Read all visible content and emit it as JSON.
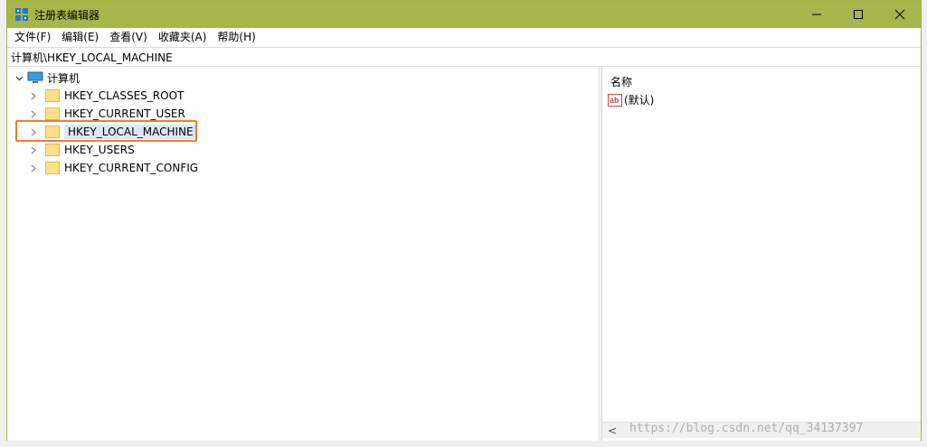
{
  "window": {
    "title": "注册表编辑器",
    "controls": [
      "minimize-icon",
      "maximize-icon",
      "close-icon"
    ]
  },
  "menubar": {
    "items": [
      {
        "label": "文件(F)"
      },
      {
        "label": "编辑(E)"
      },
      {
        "label": "查看(V)"
      },
      {
        "label": "收藏夹(A)"
      },
      {
        "label": "帮助(H)"
      }
    ]
  },
  "address": {
    "path": "计算机\\HKEY_LOCAL_MACHINE"
  },
  "tree": {
    "root": {
      "label": "计算机",
      "expanded": true,
      "icon": "computer-icon"
    },
    "children": [
      {
        "label": "HKEY_CLASSES_ROOT"
      },
      {
        "label": "HKEY_CURRENT_USER"
      },
      {
        "label": "HKEY_LOCAL_MACHINE",
        "selected": true
      },
      {
        "label": "HKEY_USERS"
      },
      {
        "label": "HKEY_CURRENT_CONFIG"
      }
    ]
  },
  "values": {
    "column_name": "名称",
    "rows": [
      {
        "name": "(默认)",
        "icon": "string-value-icon"
      }
    ]
  },
  "watermark": "https://blog.csdn.net/qq_34137397",
  "colors": {
    "titlebar": "#a6b64a",
    "highlight_box": "#f07e2b",
    "selection": "#dbe9f7"
  }
}
